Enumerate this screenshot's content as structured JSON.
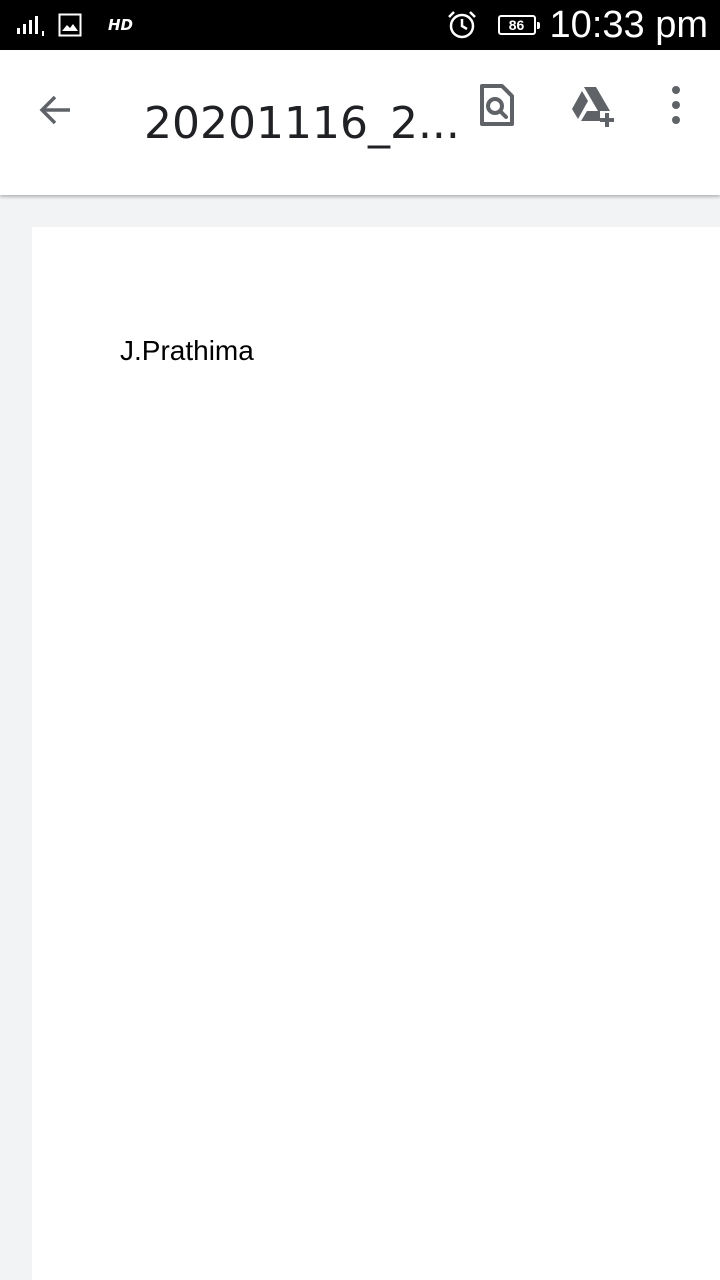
{
  "status_bar": {
    "network_label": "HD",
    "battery_level": "86",
    "time": "10:33 pm",
    "icons": [
      "signal-icon",
      "gallery-icon",
      "alarm-icon",
      "battery-icon"
    ]
  },
  "toolbar": {
    "title": "20201116_2...",
    "icons": [
      "back-arrow-icon",
      "find-in-page-icon",
      "drive-add-icon",
      "more-vert-icon"
    ]
  },
  "document": {
    "text": "J.Prathima"
  },
  "colors": {
    "status_bar_bg": "#000000",
    "toolbar_bg": "#ffffff",
    "viewer_bg": "#f1f3f4",
    "icon_gray": "#5f6368",
    "page_bg": "#ffffff"
  }
}
